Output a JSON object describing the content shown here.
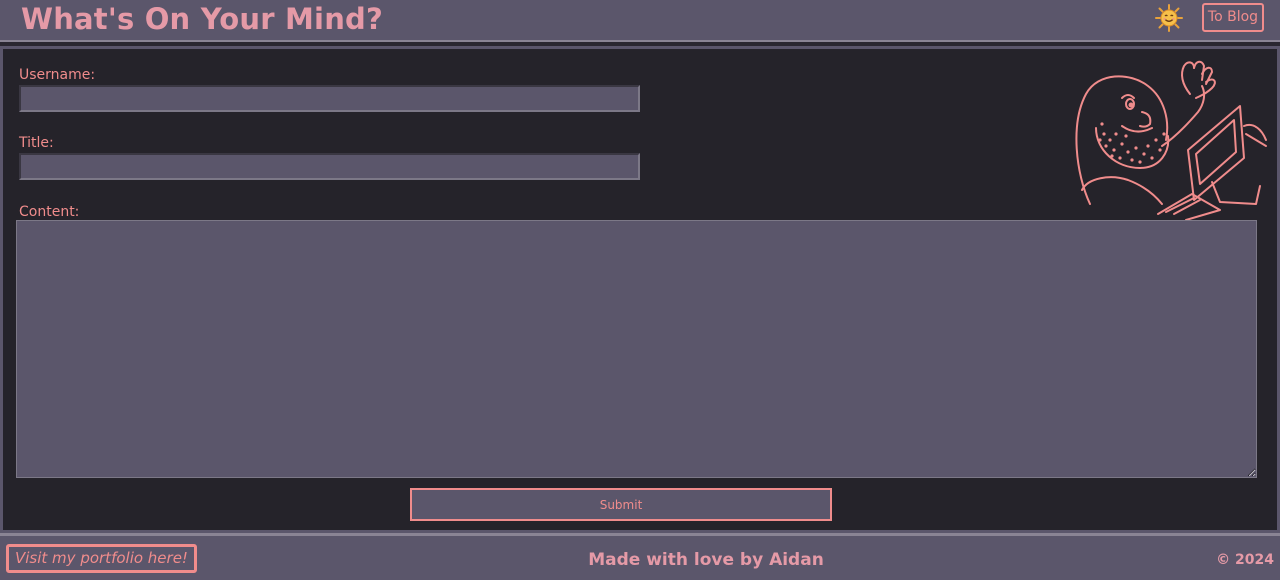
{
  "header": {
    "title": "What's On Your Mind?",
    "theme_icon": "smiling-sun-icon",
    "blog_link_label": "To Blog"
  },
  "form": {
    "username_label": "Username:",
    "username_value": "",
    "title_label": "Title:",
    "title_value": "",
    "content_label": "Content:",
    "content_value": "",
    "submit_label": "Submit",
    "mascot_icon": "waving-bearded-man-at-computer-icon"
  },
  "footer": {
    "portfolio_label": "Visit my portfolio here!",
    "credit": "Made with love by Aidan",
    "copyright": "© 2024"
  },
  "colors": {
    "background": "#5b566b",
    "panel": "#25232a",
    "accent": "#f08c8c",
    "title": "#e59aa7"
  }
}
